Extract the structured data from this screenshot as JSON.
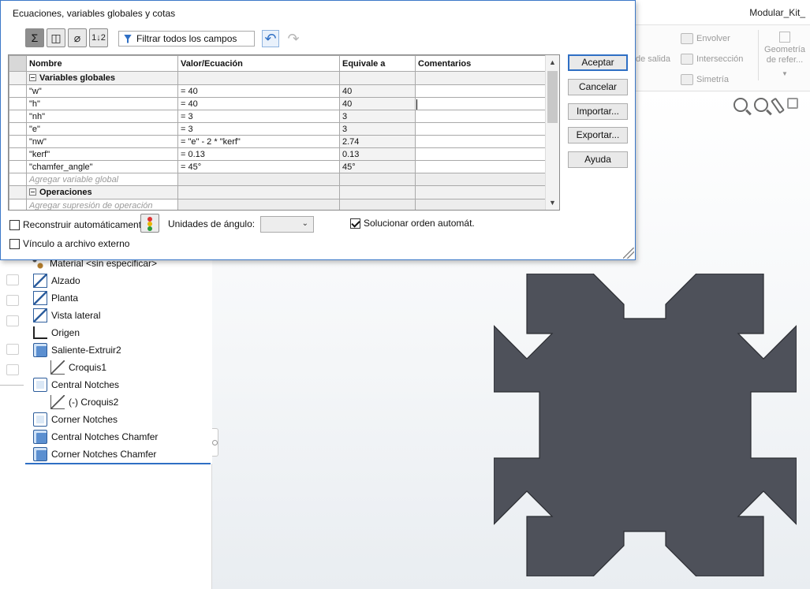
{
  "app": {
    "document_title": "Modular_Kit_",
    "ribbon": {
      "envolver": "Envolver",
      "salida": "de salida",
      "interseccion": "Intersección",
      "simetria": "Simetría",
      "geometria": "Geometría de refer..."
    }
  },
  "dialog": {
    "title": "Ecuaciones, variables globales y cotas",
    "filter_label": "Filtrar todos los campos",
    "toolbar_icons": [
      "sum-view-icon",
      "sketch-view-icon",
      "dimension-view-icon",
      "ordered-view-icon"
    ],
    "columns": [
      "Nombre",
      "Valor/Ecuación",
      "Equivale a",
      "Comentarios"
    ],
    "groups": {
      "global_vars": "Variables globales",
      "operations": "Operaciones"
    },
    "variables": [
      {
        "name": "\"w\"",
        "value": "= 40",
        "result": "40",
        "comment": ""
      },
      {
        "name": "\"h\"",
        "value": "= 40",
        "result": "40",
        "comment": ""
      },
      {
        "name": "\"nh\"",
        "value": "= 3",
        "result": "3",
        "comment": ""
      },
      {
        "name": "\"e\"",
        "value": "= 3",
        "result": "3",
        "comment": ""
      },
      {
        "name": "\"nw\"",
        "value": "= \"e\" - 2 * \"kerf\"",
        "result": "2.74",
        "comment": ""
      },
      {
        "name": "\"kerf\"",
        "value": "= 0.13",
        "result": "0.13",
        "comment": ""
      },
      {
        "name": "\"chamfer_angle\"",
        "value": "= 45°",
        "result": "45°",
        "comment": ""
      }
    ],
    "add_global": "Agregar variable global",
    "add_operation": "Agregar supresión de operación",
    "buttons": {
      "ok": "Aceptar",
      "cancel": "Cancelar",
      "import": "Importar...",
      "export": "Exportar...",
      "help": "Ayuda"
    },
    "rebuild_label": "Reconstruir automáticament",
    "rebuild_checked": false,
    "link_label": "Vínculo a archivo externo",
    "link_checked": false,
    "angle_units_label": "Unidades de ángulo:",
    "angle_units_value": "",
    "auto_order_label": "Solucionar orden automát.",
    "auto_order_checked": true
  },
  "tree": {
    "items": [
      {
        "label": "Material <sin especificar>",
        "icon": "material-icon"
      },
      {
        "label": "Alzado",
        "icon": "plane-icon"
      },
      {
        "label": "Planta",
        "icon": "plane-icon"
      },
      {
        "label": "Vista lateral",
        "icon": "plane-icon"
      },
      {
        "label": "Origen",
        "icon": "origin-icon"
      },
      {
        "label": "Saliente-Extruir2",
        "icon": "extrude-icon"
      },
      {
        "label": "Croquis1",
        "icon": "sketch-icon"
      },
      {
        "label": "Central Notches",
        "icon": "cut-extrude-icon"
      },
      {
        "label": "(-) Croquis2",
        "icon": "sketch-icon"
      },
      {
        "label": "Corner Notches",
        "icon": "cut-extrude-icon"
      },
      {
        "label": "Central Notches Chamfer",
        "icon": "chamfer-icon"
      },
      {
        "label": "Corner Notches Chamfer",
        "icon": "chamfer-icon"
      }
    ]
  },
  "colors": {
    "part": "#4e515a",
    "accent": "#2f6fc4"
  }
}
